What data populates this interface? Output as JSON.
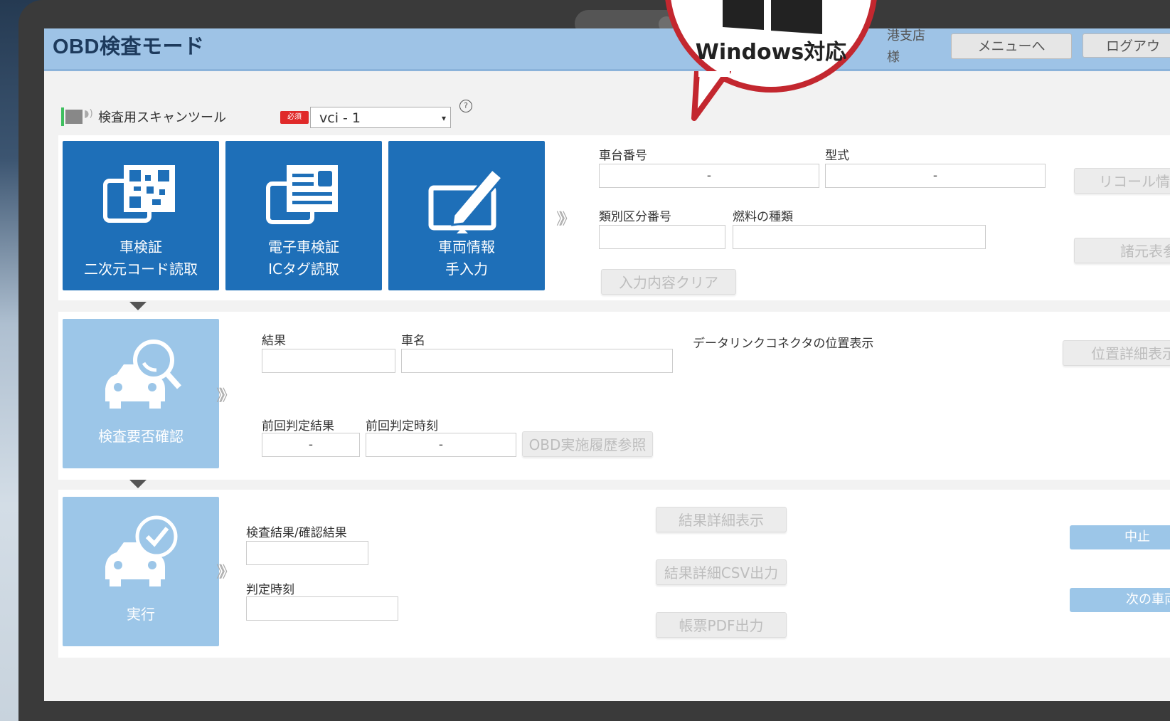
{
  "app": {
    "title": "OBD検査モード",
    "user_line1": "港支店",
    "user_line2": "様",
    "menu_button": "メニューへ",
    "logout_button": "ログアウ"
  },
  "callout": {
    "text": "Windows対応"
  },
  "scan_tool": {
    "label": "検査用スキャンツール",
    "required_badge": "必須",
    "selected": "vci - 1",
    "help": "?"
  },
  "vehicle_section": {
    "tiles": [
      {
        "line1": "車検証",
        "line2": "二次元コード読取"
      },
      {
        "line1": "電子車検証",
        "line2": "ICタグ読取"
      },
      {
        "line1": "車両情報",
        "line2": "手入力"
      }
    ],
    "chassis_number": {
      "label": "車台番号",
      "value": "-"
    },
    "model": {
      "label": "型式",
      "value": "-"
    },
    "category_number": {
      "label": "類別区分番号",
      "value": ""
    },
    "fuel_type": {
      "label": "燃料の種類",
      "value": ""
    },
    "clear_button": "入力内容クリア",
    "recall_button": "リコール情報",
    "spec_button": "諸元表参照"
  },
  "necessity_section": {
    "tile_label": "検査要否確認",
    "result": {
      "label": "結果",
      "value": ""
    },
    "vehicle_name": {
      "label": "車名",
      "value": ""
    },
    "dlc_label": "データリンクコネクタの位置表示",
    "position_detail_button": "位置詳細表示",
    "previous_result": {
      "label": "前回判定結果",
      "value": "-"
    },
    "previous_time": {
      "label": "前回判定時刻",
      "value": "-"
    },
    "history_button": "OBD実施履歴参照"
  },
  "execute_section": {
    "tile_label": "実行",
    "inspection_result": {
      "label": "検査結果/確認結果",
      "value": ""
    },
    "judgment_time": {
      "label": "判定時刻",
      "value": ""
    },
    "detail_button": "結果詳細表示",
    "csv_button": "結果詳細CSV出力",
    "pdf_button": "帳票PDF出力",
    "stop_button": "中止",
    "next_button": "次の車両"
  },
  "arrow_glyph": "》》",
  "colors": {
    "accent_dark": "#1e6fb8",
    "accent_light": "#9cc6e8",
    "header": "#9ec3e6",
    "callout_red": "#c3272f"
  }
}
